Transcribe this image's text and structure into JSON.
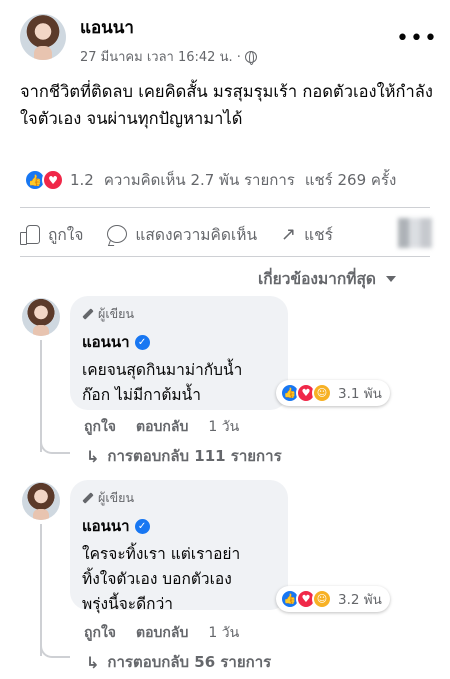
{
  "post": {
    "author": "แอนนา",
    "timestamp": "27 มีนาคม เวลา 16:42 น. ·",
    "more_icon": "more-horizontal-icon",
    "privacy_icon": "globe-icon",
    "text": "จากชีวิตที่ติดลบ เคยคิดสั้น มรสุมรุมเร้า กอดตัวเองให้กำลังใจตัวเอง จนผ่านทุกปัญหามาได้",
    "reactions_count": "1.2",
    "comments_count": "ความคิดเห็น 2.7 พัน รายการ",
    "shares_count": "แชร์ 269 ครั้ง",
    "reaction_icons": [
      "like-icon",
      "love-icon"
    ]
  },
  "actions": {
    "like_label": "ถูกใจ",
    "comment_label": "แสดงความคิดเห็น",
    "share_label": "แชร์"
  },
  "sort": {
    "label": "เกี่ยวข้องมากที่สุด"
  },
  "comments": [
    {
      "badge": "ผู้เขียน",
      "author": "แอนนา",
      "text_line1": "เคยจนสุดกินมาม่ากับน้ำ",
      "text_line2": "ก๊อก ไม่มีกาต้มน้ำ",
      "reactions": "3.1 พัน",
      "like_label": "ถูกใจ",
      "reply_label": "ตอบกลับ",
      "time": "1 วัน",
      "replies_label": "การตอบกลับ 111 รายการ"
    },
    {
      "badge": "ผู้เขียน",
      "author": "แอนนา",
      "text_line1": "ใครจะทิ้งเรา แต่เราอย่า",
      "text_line2": "ทิ้งใจตัวเอง บอกตัวเอง",
      "text_line3": "พรุ่งนี้จะดีกว่า",
      "reactions": "3.2 พัน",
      "like_label": "ถูกใจ",
      "reply_label": "ตอบกลับ",
      "time": "1 วัน",
      "replies_label": "การตอบกลับ 56 รายการ"
    }
  ],
  "colors": {
    "accent": "#1877f2",
    "love": "#f02849",
    "care": "#f7b125",
    "muted": "#65676b",
    "bubble": "#f0f2f5"
  }
}
